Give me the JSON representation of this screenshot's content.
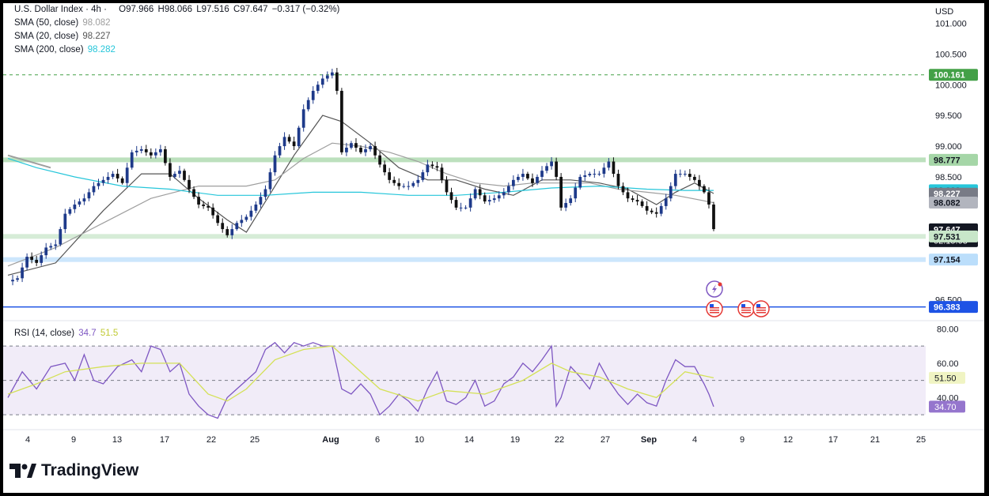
{
  "header": {
    "symbol": "U.S. Dollar Index · 4h ·",
    "o_label": "O",
    "o": "97.966",
    "h_label": "H",
    "h": "98.066",
    "l_label": "L",
    "l": "97.516",
    "c_label": "C",
    "c": "97.647",
    "change": "−0.317 (−0.32%)"
  },
  "indicators": {
    "sma50": {
      "label": "SMA (50, close)",
      "value": "98.082",
      "color": "#9e9e9e"
    },
    "sma20": {
      "label": "SMA (20, close)",
      "value": "98.227",
      "color": "#555555"
    },
    "sma200": {
      "label": "SMA (200, close)",
      "value": "98.282",
      "color": "#26c6da"
    }
  },
  "currency": "USD",
  "brand": "TradingView",
  "chart_data": [
    {
      "type": "candlestick",
      "ylim": [
        96.25,
        101.25
      ],
      "y_ticks": [
        "101.000",
        "100.500",
        "100.000",
        "99.500",
        "99.000",
        "98.500",
        "96.500"
      ],
      "x_ticks": [
        "4",
        "9",
        "13",
        "17",
        "22",
        "25",
        "Aug",
        "6",
        "10",
        "14",
        "19",
        "22",
        "27",
        "Sep",
        "4",
        "9",
        "12",
        "17",
        "21",
        "25"
      ],
      "price_path": [
        [
          0,
          96.8
        ],
        [
          2,
          96.85
        ],
        [
          4,
          97.2
        ],
        [
          6,
          97.1
        ],
        [
          8,
          97.35
        ],
        [
          10,
          97.4
        ],
        [
          12,
          97.9
        ],
        [
          14,
          98.05
        ],
        [
          16,
          98.15
        ],
        [
          18,
          98.35
        ],
        [
          20,
          98.45
        ],
        [
          22,
          98.55
        ],
        [
          24,
          98.4
        ],
        [
          26,
          98.9
        ],
        [
          28,
          98.95
        ],
        [
          30,
          98.85
        ],
        [
          32,
          98.95
        ],
        [
          34,
          98.5
        ],
        [
          36,
          98.6
        ],
        [
          38,
          98.3
        ],
        [
          40,
          98.05
        ],
        [
          42,
          98.0
        ],
        [
          44,
          97.75
        ],
        [
          46,
          97.55
        ],
        [
          48,
          97.75
        ],
        [
          50,
          97.85
        ],
        [
          52,
          98.05
        ],
        [
          54,
          98.3
        ],
        [
          56,
          98.85
        ],
        [
          58,
          99.15
        ],
        [
          60,
          99.0
        ],
        [
          62,
          99.6
        ],
        [
          64,
          99.9
        ],
        [
          66,
          100.1
        ],
        [
          68,
          100.2
        ],
        [
          69,
          99.9
        ],
        [
          70,
          98.9
        ],
        [
          72,
          99.05
        ],
        [
          74,
          98.9
        ],
        [
          76,
          99.0
        ],
        [
          78,
          98.7
        ],
        [
          80,
          98.45
        ],
        [
          82,
          98.35
        ],
        [
          84,
          98.35
        ],
        [
          86,
          98.45
        ],
        [
          88,
          98.7
        ],
        [
          90,
          98.65
        ],
        [
          92,
          98.25
        ],
        [
          94,
          98.0
        ],
        [
          96,
          98.0
        ],
        [
          98,
          98.3
        ],
        [
          100,
          98.1
        ],
        [
          102,
          98.15
        ],
        [
          104,
          98.25
        ],
        [
          106,
          98.45
        ],
        [
          108,
          98.55
        ],
        [
          110,
          98.4
        ],
        [
          112,
          98.6
        ],
        [
          114,
          98.75
        ],
        [
          115,
          98.5
        ],
        [
          116,
          98.0
        ],
        [
          118,
          98.15
        ],
        [
          120,
          98.5
        ],
        [
          122,
          98.55
        ],
        [
          124,
          98.55
        ],
        [
          126,
          98.75
        ],
        [
          128,
          98.35
        ],
        [
          130,
          98.15
        ],
        [
          132,
          98.1
        ],
        [
          134,
          97.95
        ],
        [
          136,
          97.9
        ],
        [
          138,
          98.15
        ],
        [
          140,
          98.55
        ],
        [
          142,
          98.55
        ],
        [
          144,
          98.45
        ],
        [
          146,
          98.25
        ],
        [
          147,
          98.05
        ],
        [
          148,
          97.65
        ]
      ],
      "series": [
        {
          "name": "SMA (20, close)",
          "last": 98.227,
          "color": "#555555",
          "path": [
            [
              0,
              96.9
            ],
            [
              10,
              97.1
            ],
            [
              20,
              97.95
            ],
            [
              28,
              98.55
            ],
            [
              34,
              98.55
            ],
            [
              40,
              98.15
            ],
            [
              46,
              97.8
            ],
            [
              50,
              97.6
            ],
            [
              54,
              98.1
            ],
            [
              60,
              98.85
            ],
            [
              66,
              99.5
            ],
            [
              70,
              99.4
            ],
            [
              76,
              99.05
            ],
            [
              82,
              98.65
            ],
            [
              88,
              98.45
            ],
            [
              94,
              98.45
            ],
            [
              100,
              98.3
            ],
            [
              106,
              98.2
            ],
            [
              112,
              98.45
            ],
            [
              118,
              98.45
            ],
            [
              124,
              98.4
            ],
            [
              130,
              98.3
            ],
            [
              136,
              98.05
            ],
            [
              140,
              98.25
            ],
            [
              144,
              98.4
            ],
            [
              148,
              98.23
            ]
          ]
        },
        {
          "name": "SMA (50, close)",
          "last": 98.082,
          "color": "#9e9e9e",
          "path": [
            [
              0,
              97.05
            ],
            [
              10,
              97.35
            ],
            [
              20,
              97.75
            ],
            [
              30,
              98.15
            ],
            [
              40,
              98.35
            ],
            [
              50,
              98.35
            ],
            [
              56,
              98.45
            ],
            [
              62,
              98.8
            ],
            [
              68,
              99.05
            ],
            [
              74,
              99.0
            ],
            [
              80,
              98.9
            ],
            [
              86,
              98.75
            ],
            [
              92,
              98.55
            ],
            [
              98,
              98.4
            ],
            [
              104,
              98.35
            ],
            [
              110,
              98.4
            ],
            [
              116,
              98.4
            ],
            [
              122,
              98.4
            ],
            [
              128,
              98.3
            ],
            [
              134,
              98.25
            ],
            [
              140,
              98.2
            ],
            [
              148,
              98.08
            ]
          ]
        },
        {
          "name": "SMA (200, close)",
          "last": 98.282,
          "color": "#26c6da",
          "path": [
            [
              0,
              98.8
            ],
            [
              6,
              98.65
            ],
            [
              14,
              98.5
            ],
            [
              24,
              98.35
            ],
            [
              34,
              98.3
            ],
            [
              44,
              98.2
            ],
            [
              54,
              98.2
            ],
            [
              64,
              98.25
            ],
            [
              74,
              98.25
            ],
            [
              84,
              98.2
            ],
            [
              94,
              98.2
            ],
            [
              104,
              98.25
            ],
            [
              114,
              98.32
            ],
            [
              124,
              98.35
            ],
            [
              134,
              98.3
            ],
            [
              142,
              98.28
            ],
            [
              148,
              98.28
            ]
          ]
        }
      ],
      "levels": [
        {
          "value": 100.161,
          "label": "100.161",
          "color": "#43a047",
          "style": "dashed"
        },
        {
          "value": 98.777,
          "label": "98.777",
          "color": "#a5d6a7",
          "style": "band"
        },
        {
          "value": 97.531,
          "label": "97.531",
          "color": "#c8e6c9",
          "style": "band"
        },
        {
          "value": 97.154,
          "label": "97.154",
          "color": "#bbdefb",
          "style": "band"
        },
        {
          "value": 96.383,
          "label": "96.383",
          "color": "#1e53e5",
          "style": "solid"
        }
      ],
      "price_tags": [
        {
          "label": "100.161",
          "value": 100.161,
          "bg": "#43a047",
          "fg": "#ffffff"
        },
        {
          "label": "98.777",
          "value": 98.777,
          "bg": "#a5d6a7",
          "fg": "#131722"
        },
        {
          "label": "98.282",
          "value": 98.282,
          "bg": "#26c6da",
          "fg": "#131722"
        },
        {
          "label": "98.227",
          "value": 98.227,
          "bg": "#787b86",
          "fg": "#ffffff"
        },
        {
          "label": "98.082",
          "value": 98.082,
          "bg": "#b2b5be",
          "fg": "#131722"
        },
        {
          "label": "97.647",
          "value": 97.647,
          "bg": "#131722",
          "fg": "#ffffff",
          "sub": "02:15:03"
        },
        {
          "label": "97.531",
          "value": 97.531,
          "bg": "#c8e6c9",
          "fg": "#131722"
        },
        {
          "label": "97.154",
          "value": 97.154,
          "bg": "#bbdefb",
          "fg": "#131722"
        },
        {
          "label": "96.383",
          "value": 96.383,
          "bg": "#1e53e5",
          "fg": "#ffffff"
        }
      ],
      "events": [
        "lightning-icon",
        "us-flag-icon",
        "us-flag-icon",
        "us-flag-icon"
      ]
    },
    {
      "type": "line",
      "title": "RSI (14, close)",
      "ylim": [
        25,
        82
      ],
      "y_ticks": [
        "80.00",
        "60.00",
        "40.00"
      ],
      "band": [
        30,
        70
      ],
      "series": [
        {
          "name": "RSI",
          "last": 34.7,
          "color": "#7e57c2",
          "path": [
            [
              0,
              40
            ],
            [
              3,
              55
            ],
            [
              6,
              45
            ],
            [
              9,
              58
            ],
            [
              12,
              60
            ],
            [
              14,
              50
            ],
            [
              16,
              65
            ],
            [
              18,
              50
            ],
            [
              20,
              48
            ],
            [
              23,
              58
            ],
            [
              26,
              62
            ],
            [
              28,
              55
            ],
            [
              30,
              70
            ],
            [
              32,
              68
            ],
            [
              34,
              55
            ],
            [
              36,
              60
            ],
            [
              38,
              42
            ],
            [
              40,
              35
            ],
            [
              42,
              30
            ],
            [
              44,
              28
            ],
            [
              46,
              40
            ],
            [
              48,
              45
            ],
            [
              50,
              50
            ],
            [
              52,
              55
            ],
            [
              54,
              68
            ],
            [
              56,
              72
            ],
            [
              58,
              66
            ],
            [
              60,
              72
            ],
            [
              62,
              70
            ],
            [
              64,
              72
            ],
            [
              66,
              70
            ],
            [
              68,
              70
            ],
            [
              70,
              45
            ],
            [
              72,
              42
            ],
            [
              74,
              48
            ],
            [
              76,
              42
            ],
            [
              78,
              30
            ],
            [
              80,
              35
            ],
            [
              82,
              42
            ],
            [
              84,
              38
            ],
            [
              86,
              32
            ],
            [
              88,
              45
            ],
            [
              90,
              55
            ],
            [
              92,
              38
            ],
            [
              94,
              36
            ],
            [
              96,
              40
            ],
            [
              98,
              50
            ],
            [
              100,
              35
            ],
            [
              102,
              38
            ],
            [
              104,
              48
            ],
            [
              106,
              52
            ],
            [
              108,
              60
            ],
            [
              110,
              55
            ],
            [
              112,
              62
            ],
            [
              114,
              70
            ],
            [
              115,
              35
            ],
            [
              116,
              40
            ],
            [
              118,
              58
            ],
            [
              120,
              52
            ],
            [
              122,
              45
            ],
            [
              124,
              60
            ],
            [
              126,
              50
            ],
            [
              128,
              42
            ],
            [
              130,
              36
            ],
            [
              132,
              42
            ],
            [
              134,
              37
            ],
            [
              136,
              35
            ],
            [
              138,
              50
            ],
            [
              140,
              62
            ],
            [
              142,
              58
            ],
            [
              144,
              58
            ],
            [
              146,
              48
            ],
            [
              147,
              42
            ],
            [
              148,
              34.7
            ]
          ]
        },
        {
          "name": "MA",
          "last": 51.5,
          "color": "#d4e157",
          "path": [
            [
              0,
              42
            ],
            [
              6,
              48
            ],
            [
              12,
              55
            ],
            [
              20,
              58
            ],
            [
              28,
              60
            ],
            [
              36,
              60
            ],
            [
              42,
              42
            ],
            [
              46,
              38
            ],
            [
              50,
              45
            ],
            [
              56,
              62
            ],
            [
              62,
              68
            ],
            [
              68,
              70
            ],
            [
              72,
              60
            ],
            [
              78,
              45
            ],
            [
              86,
              38
            ],
            [
              92,
              44
            ],
            [
              100,
              42
            ],
            [
              108,
              50
            ],
            [
              114,
              60
            ],
            [
              118,
              55
            ],
            [
              124,
              52
            ],
            [
              130,
              45
            ],
            [
              136,
              40
            ],
            [
              142,
              55
            ],
            [
              148,
              51.5
            ]
          ]
        }
      ],
      "price_tags": [
        {
          "label": "51.50",
          "value": 51.5,
          "bg": "#f0f4c3",
          "fg": "#131722"
        },
        {
          "label": "34.70",
          "value": 34.7,
          "bg": "#9575cd",
          "fg": "#ffffff"
        }
      ]
    }
  ]
}
